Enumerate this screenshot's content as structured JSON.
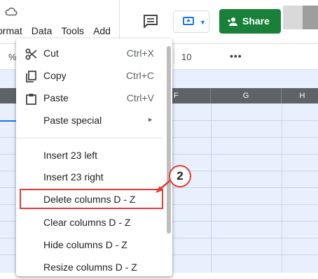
{
  "menubar": {
    "items": [
      "ormat",
      "Data",
      "Tools",
      "Add"
    ]
  },
  "toolbar": {
    "percent": "%",
    "font_size": "10",
    "more": "•••"
  },
  "header": {
    "share_label": "Share"
  },
  "columns": {
    "headers": [
      "",
      "",
      "F",
      "G",
      "H"
    ]
  },
  "context_menu": {
    "items": [
      {
        "label": "Cut",
        "shortcut": "Ctrl+X",
        "icon": "scissors-icon"
      },
      {
        "label": "Copy",
        "shortcut": "Ctrl+C",
        "icon": "copy-icon"
      },
      {
        "label": "Paste",
        "shortcut": "Ctrl+V",
        "icon": "paste-icon"
      },
      {
        "label": "Paste special",
        "shortcut": "",
        "icon": "",
        "submenu": "►"
      },
      {
        "label": "Insert 23 left",
        "shortcut": ""
      },
      {
        "label": "Insert 23 right",
        "shortcut": ""
      },
      {
        "label": "Delete columns D - Z",
        "shortcut": ""
      },
      {
        "label": "Clear columns D - Z",
        "shortcut": ""
      },
      {
        "label": "Hide columns D - Z",
        "shortcut": ""
      },
      {
        "label": "Resize columns D - Z",
        "shortcut": ""
      }
    ]
  },
  "annotation": {
    "step_number": "2",
    "color": "#e53935"
  },
  "colors": {
    "share_green": "#188038",
    "selection_blue": "#e8f0fe",
    "header_gray": "#5f6368",
    "accent_blue": "#1a73e8"
  }
}
